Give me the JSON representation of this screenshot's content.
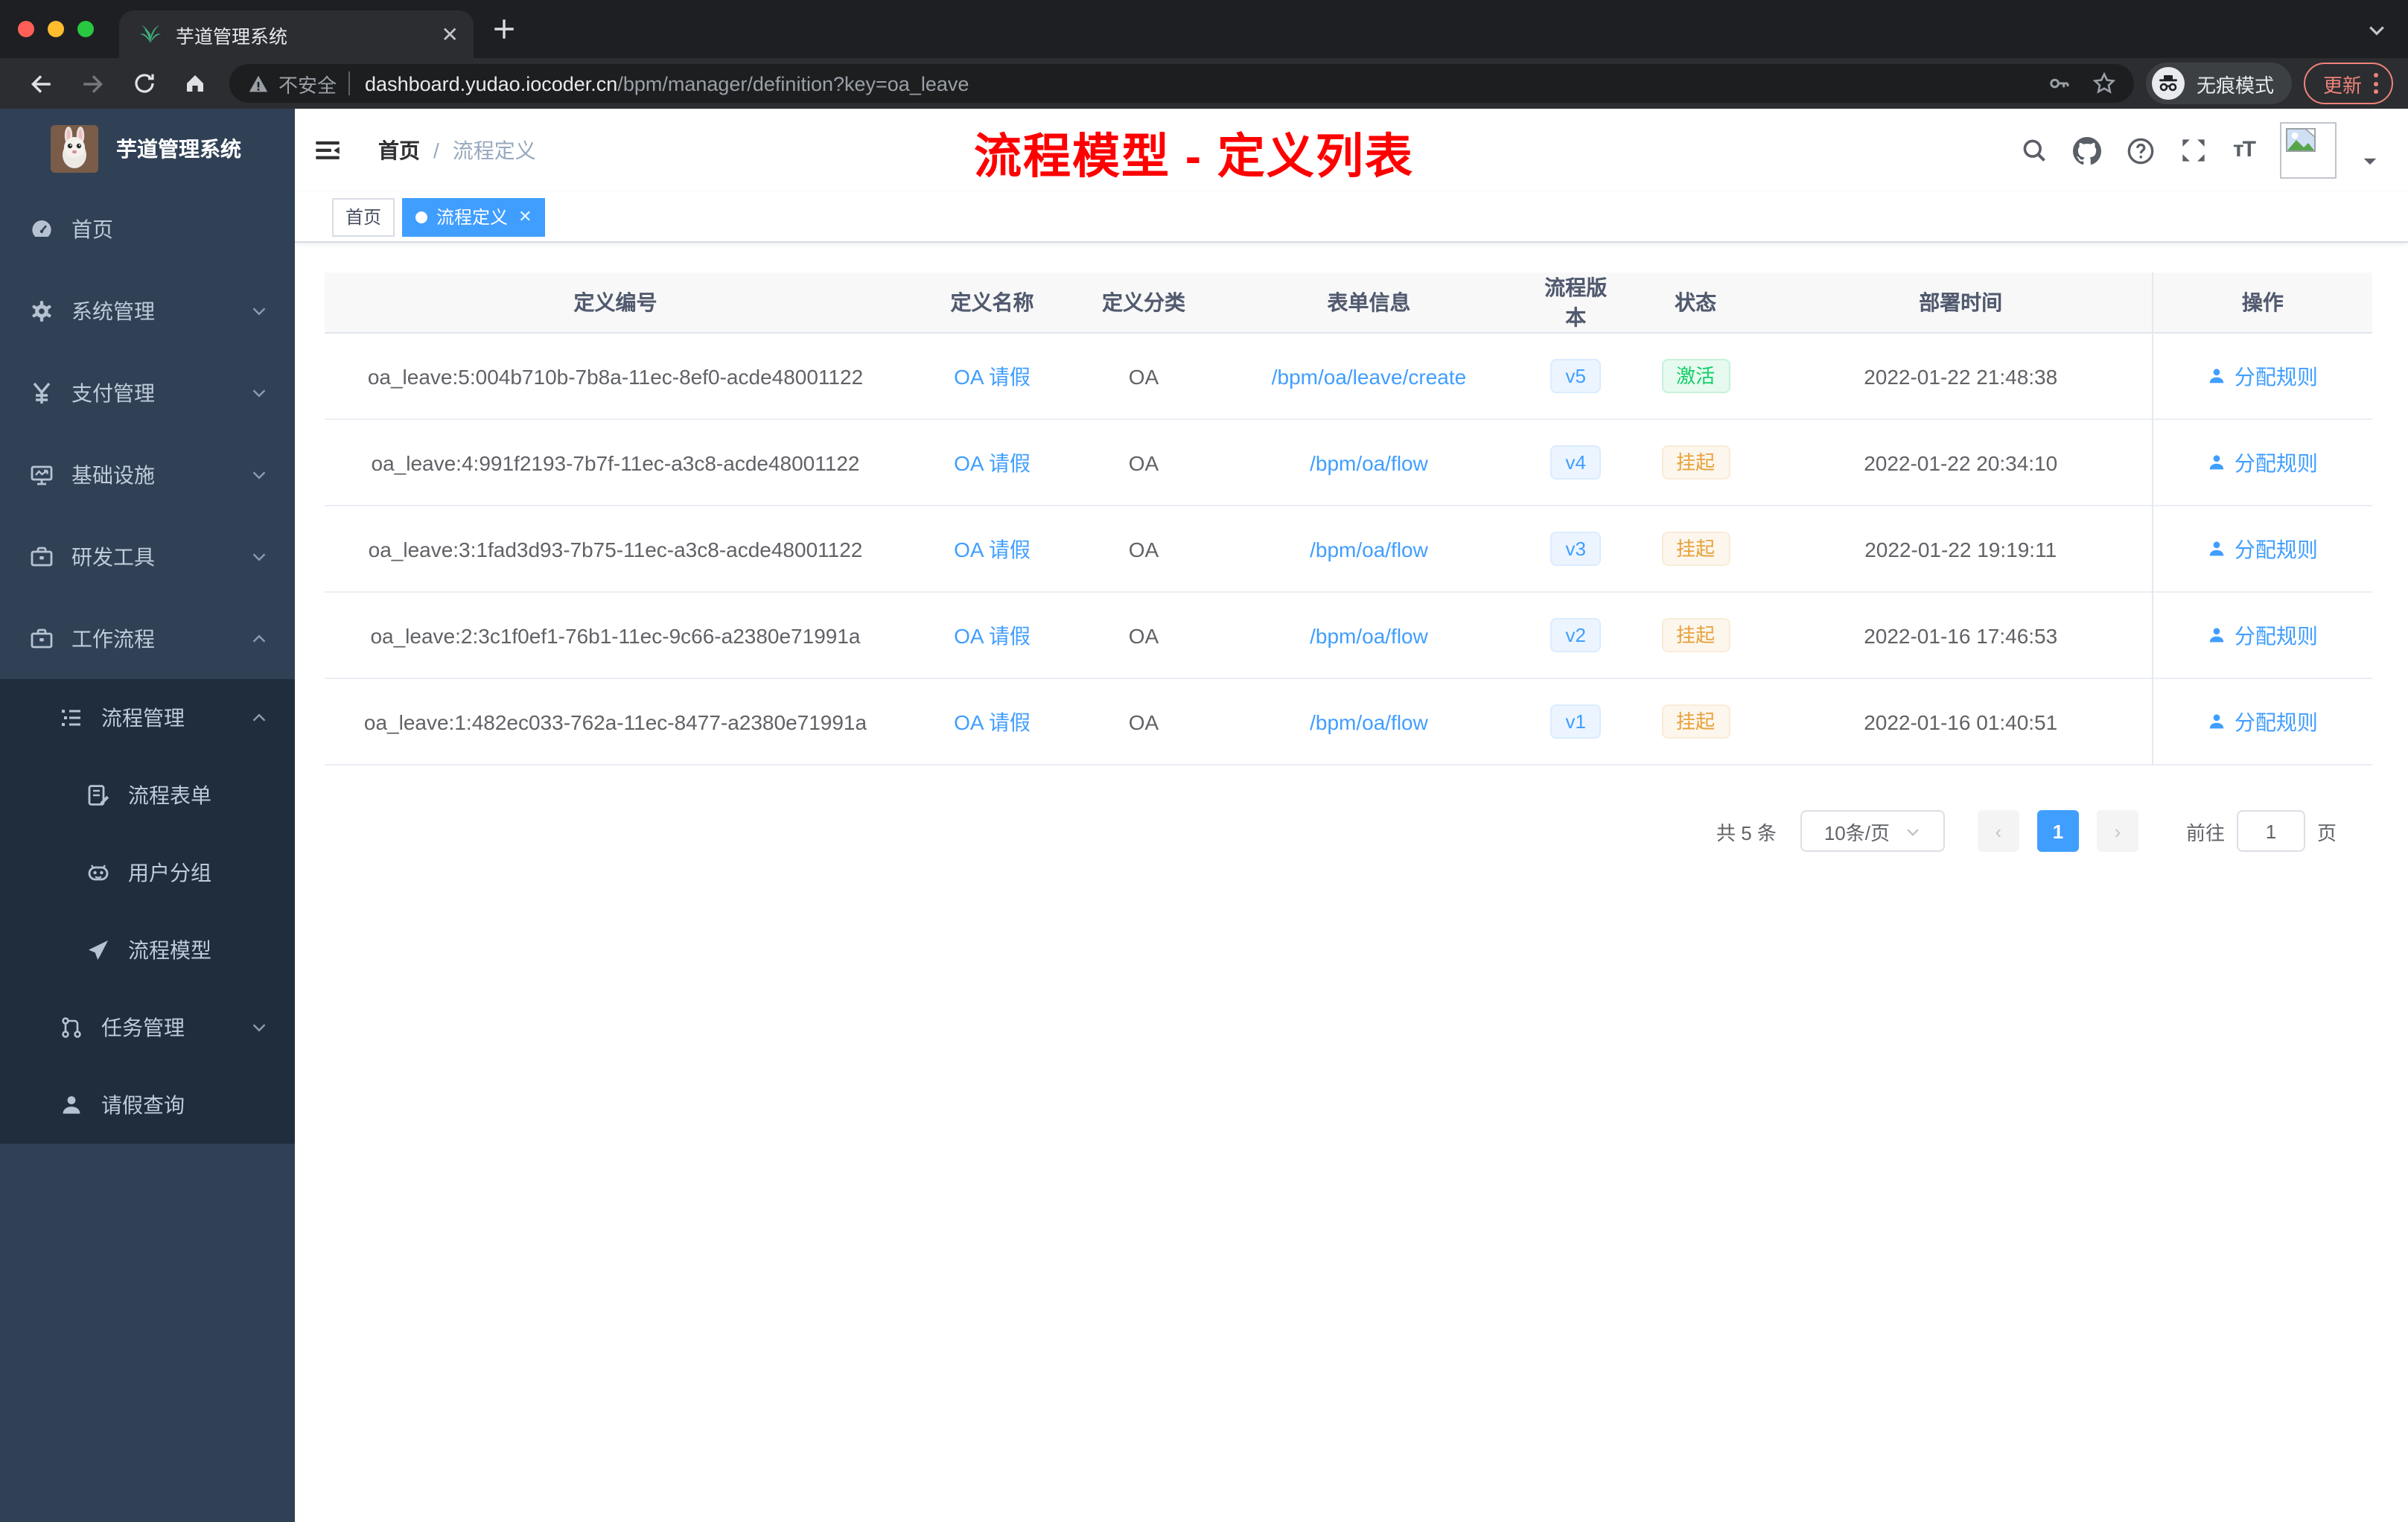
{
  "browser": {
    "tab_title": "芋道管理系统",
    "security_label": "不安全",
    "url_host": "dashboard.yudao.iocoder.cn",
    "url_path": "/bpm/manager/definition?key=oa_leave",
    "incognito_label": "无痕模式",
    "update_label": "更新"
  },
  "sidebar": {
    "app_title": "芋道管理系统",
    "items": [
      {
        "label": "首页",
        "icon": "dashboard-icon",
        "depth": 0,
        "chevron": "",
        "dark": false
      },
      {
        "label": "系统管理",
        "icon": "gear-icon",
        "depth": 0,
        "chevron": "down",
        "dark": false
      },
      {
        "label": "支付管理",
        "icon": "yen-icon",
        "depth": 0,
        "chevron": "down",
        "dark": false
      },
      {
        "label": "基础设施",
        "icon": "monitor-icon",
        "depth": 0,
        "chevron": "down",
        "dark": false
      },
      {
        "label": "研发工具",
        "icon": "toolbox-icon",
        "depth": 0,
        "chevron": "down",
        "dark": false
      },
      {
        "label": "工作流程",
        "icon": "toolbox-icon",
        "depth": 0,
        "chevron": "up",
        "dark": false
      },
      {
        "label": "流程管理",
        "icon": "tree-table-icon",
        "depth": 1,
        "chevron": "up",
        "dark": true
      },
      {
        "label": "流程表单",
        "icon": "form-icon",
        "depth": 2,
        "chevron": "",
        "dark": true
      },
      {
        "label": "用户分组",
        "icon": "robot-icon",
        "depth": 2,
        "chevron": "",
        "dark": true
      },
      {
        "label": "流程模型",
        "icon": "send-icon",
        "depth": 2,
        "chevron": "",
        "dark": true
      },
      {
        "label": "任务管理",
        "icon": "flow-icon",
        "depth": 1,
        "chevron": "down",
        "dark": true
      },
      {
        "label": "请假查询",
        "icon": "user-icon",
        "depth": 1,
        "chevron": "",
        "dark": true
      }
    ]
  },
  "header": {
    "breadcrumb_home": "首页",
    "breadcrumb_separator": "/",
    "breadcrumb_current": "流程定义",
    "annotation": "流程模型 - 定义列表"
  },
  "tags": [
    {
      "label": "首页",
      "active": false,
      "closable": false
    },
    {
      "label": "流程定义",
      "active": true,
      "closable": true
    }
  ],
  "table": {
    "columns": [
      "定义编号",
      "定义名称",
      "定义分类",
      "表单信息",
      "流程版本",
      "状态",
      "部署时间",
      "操作"
    ],
    "rows": [
      {
        "id": "oa_leave:5:004b710b-7b8a-11ec-8ef0-acde48001122",
        "name": "OA 请假",
        "category": "OA",
        "form": "/bpm/oa/leave/create",
        "version": "v5",
        "status": "激活",
        "status_type": "success",
        "deploy_time": "2022-01-22 21:48:38",
        "action": "分配规则"
      },
      {
        "id": "oa_leave:4:991f2193-7b7f-11ec-a3c8-acde48001122",
        "name": "OA 请假",
        "category": "OA",
        "form": "/bpm/oa/flow",
        "version": "v4",
        "status": "挂起",
        "status_type": "warning",
        "deploy_time": "2022-01-22 20:34:10",
        "action": "分配规则"
      },
      {
        "id": "oa_leave:3:1fad3d93-7b75-11ec-a3c8-acde48001122",
        "name": "OA 请假",
        "category": "OA",
        "form": "/bpm/oa/flow",
        "version": "v3",
        "status": "挂起",
        "status_type": "warning",
        "deploy_time": "2022-01-22 19:19:11",
        "action": "分配规则"
      },
      {
        "id": "oa_leave:2:3c1f0ef1-76b1-11ec-9c66-a2380e71991a",
        "name": "OA 请假",
        "category": "OA",
        "form": "/bpm/oa/flow",
        "version": "v2",
        "status": "挂起",
        "status_type": "warning",
        "deploy_time": "2022-01-16 17:46:53",
        "action": "分配规则"
      },
      {
        "id": "oa_leave:1:482ec033-762a-11ec-8477-a2380e71991a",
        "name": "OA 请假",
        "category": "OA",
        "form": "/bpm/oa/flow",
        "version": "v1",
        "status": "挂起",
        "status_type": "warning",
        "deploy_time": "2022-01-16 01:40:51",
        "action": "分配规则"
      }
    ]
  },
  "pagination": {
    "total_label": "共 5 条",
    "page_size_label": "10条/页",
    "prev_label": "‹",
    "current_page": "1",
    "next_label": "›",
    "goto_label": "前往",
    "goto_value": "1",
    "page_unit_label": "页"
  },
  "colors": {
    "accent_blue": "#409eff",
    "sidebar_bg": "#304156",
    "submenu_bg": "#1f2d3d",
    "annotation_red": "#fe0000",
    "status_active_green": "#13ce66",
    "status_suspend_orange": "#e6a23c"
  }
}
